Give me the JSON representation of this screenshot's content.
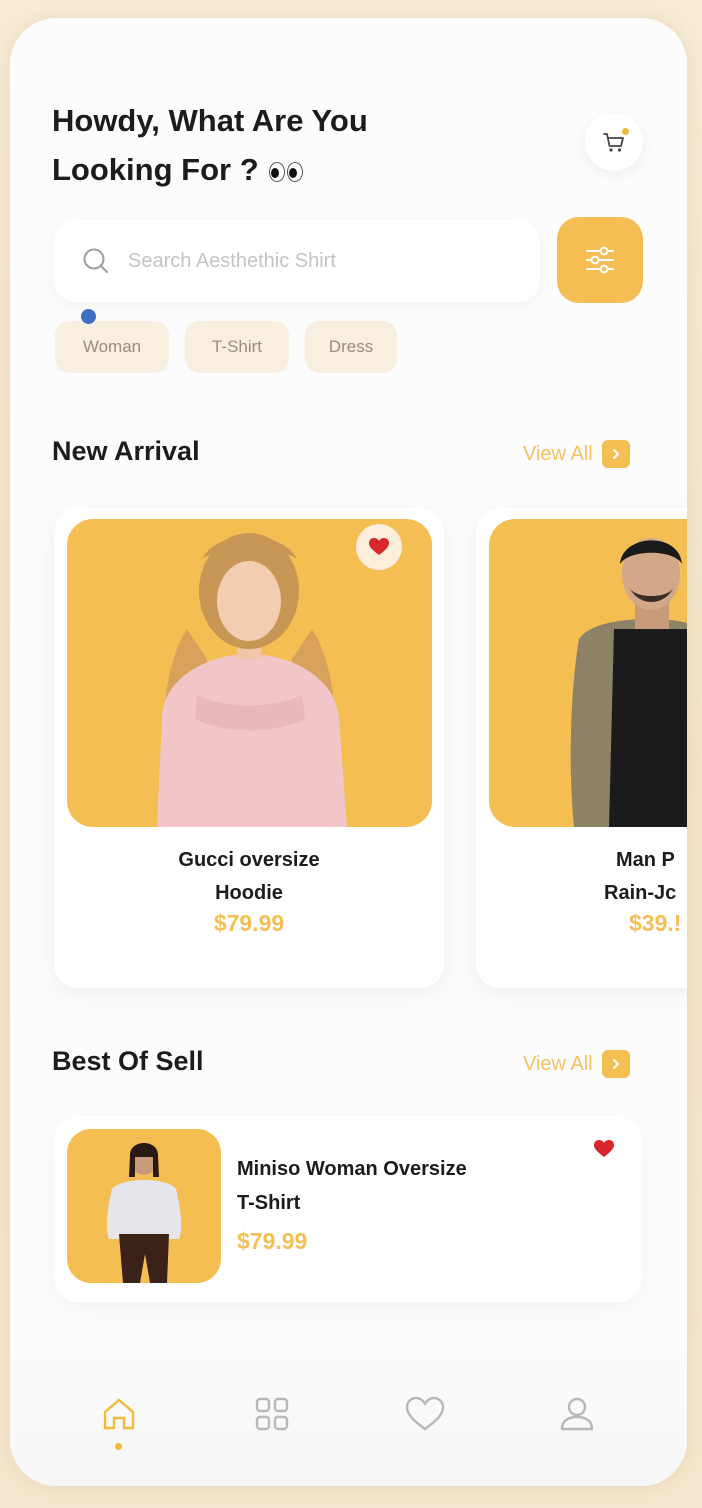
{
  "header": {
    "greeting_line1": "Howdy, What Are You",
    "greeting_line2": "Looking For ?"
  },
  "search": {
    "placeholder": "Search Aesthethic Shirt"
  },
  "categories": [
    "Woman",
    "T-Shirt",
    "Dress"
  ],
  "new_arrival": {
    "title": "New Arrival",
    "view_all": "View All",
    "products": [
      {
        "name_line1": "Gucci oversize",
        "name_line2": "Hoodie",
        "price": "$79.99"
      },
      {
        "name_line1": "Man P",
        "name_line2": "Rain-Jc",
        "price": "$39.!"
      }
    ]
  },
  "best_of_sell": {
    "title": "Best Of Sell",
    "view_all": "View All",
    "product": {
      "name_line1": "Miniso Woman Oversize",
      "name_line2": "T-Shirt",
      "price": "$79.99"
    }
  },
  "bottom_nav": [
    "home-icon",
    "grid-icon",
    "heart-icon",
    "profile-icon"
  ],
  "colors": {
    "accent": "#f5be52",
    "heart": "#d9262c",
    "text": "#1c1c1c"
  }
}
